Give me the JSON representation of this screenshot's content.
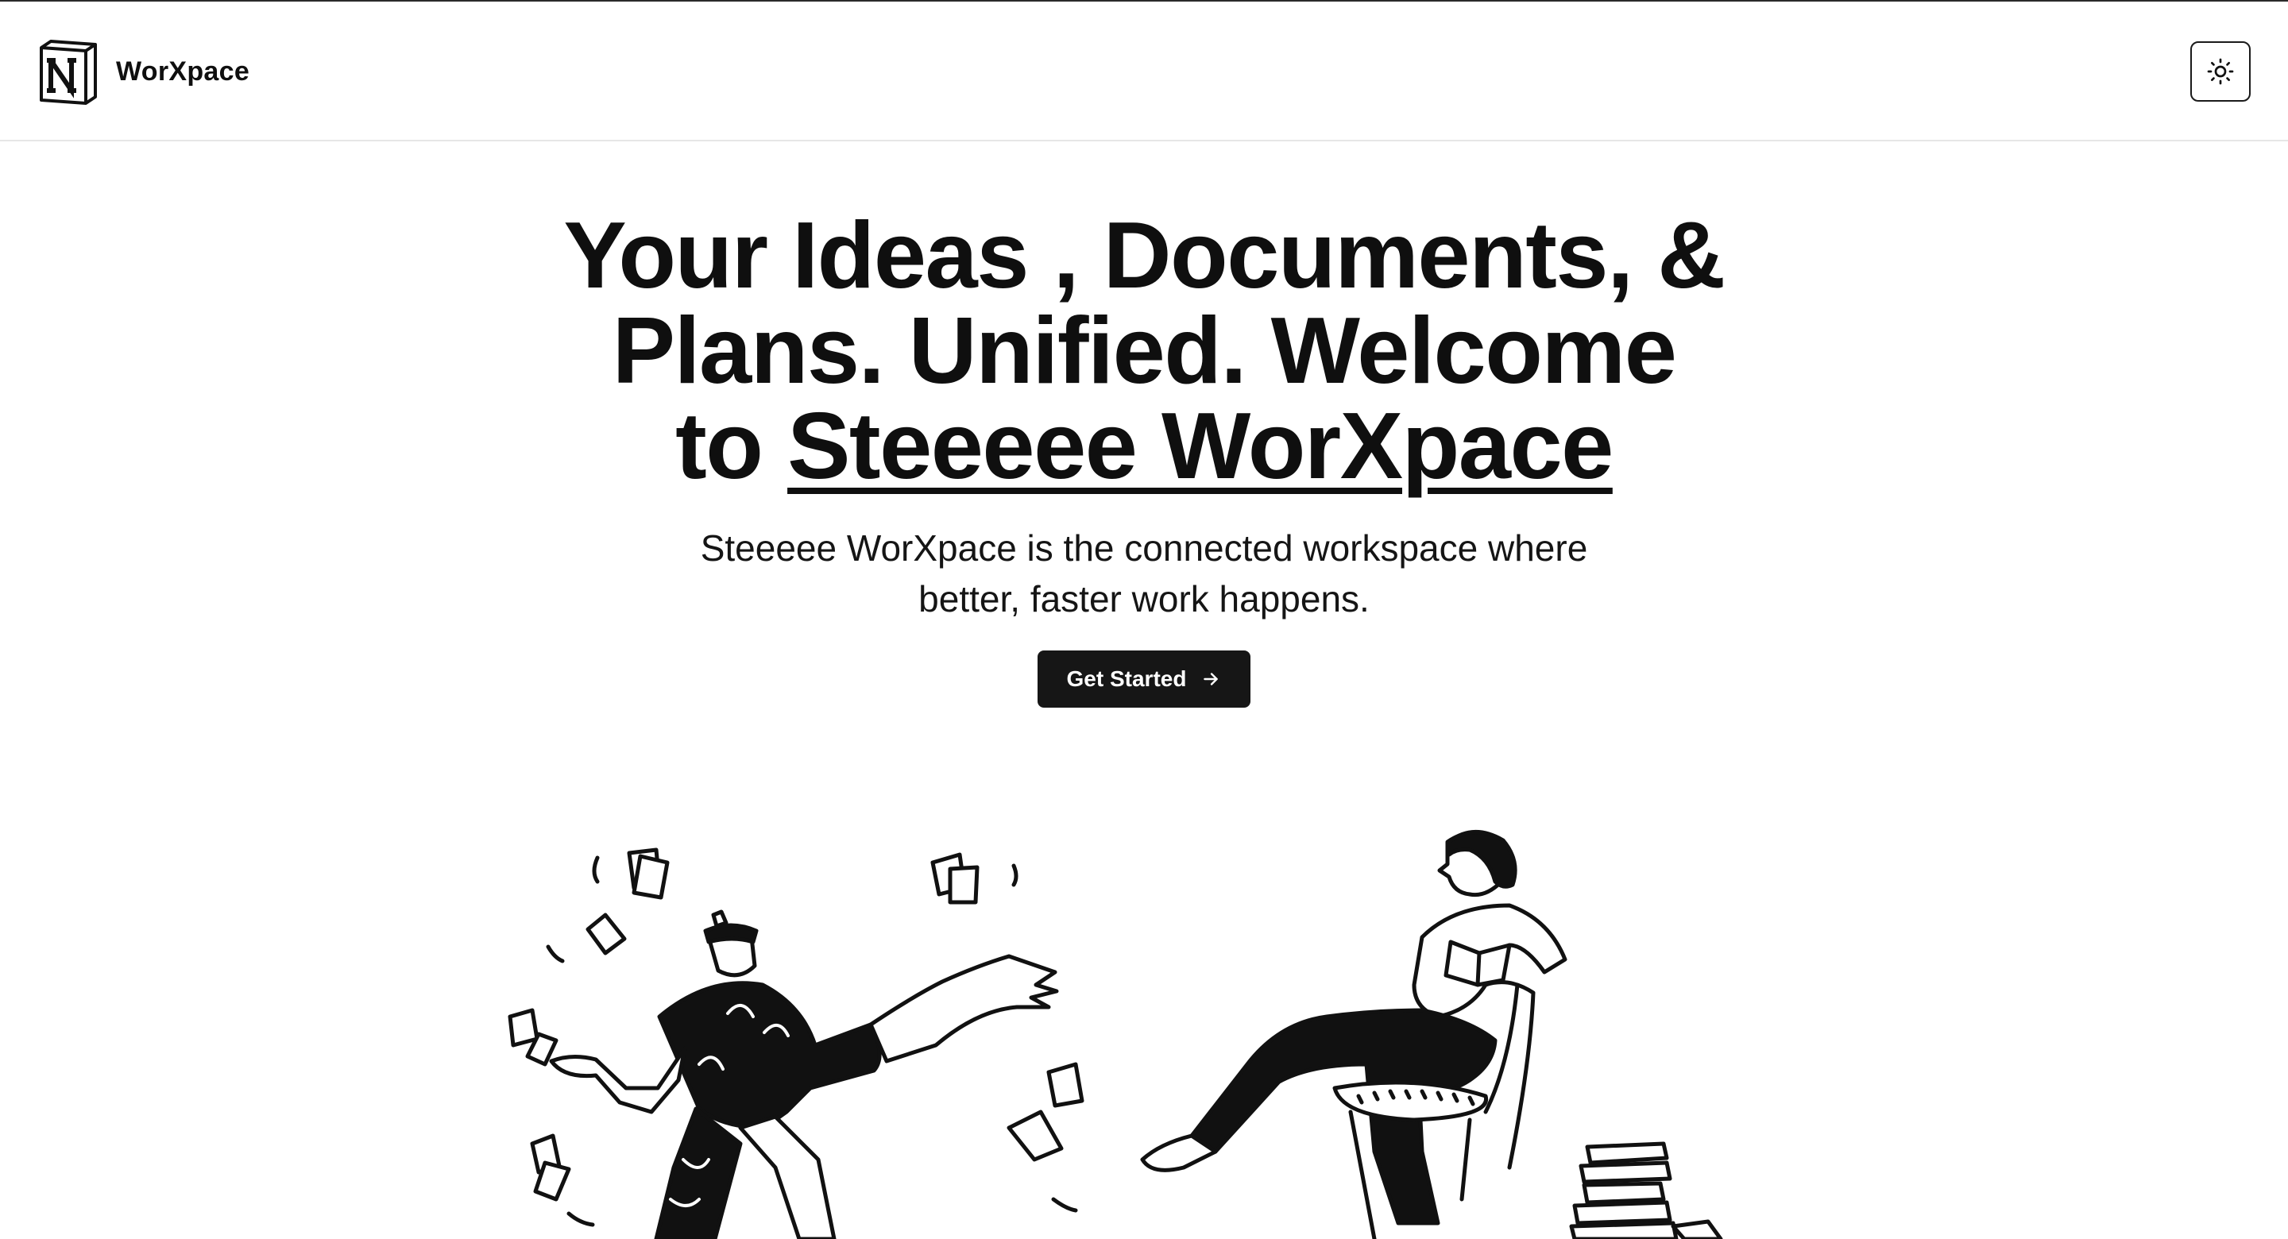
{
  "app": {
    "brand_name": "WorXpace",
    "logo": "notion-cube-logo-icon",
    "theme_toggle_icon": "sun-icon"
  },
  "hero": {
    "headline_line1": "Your Ideas , Documents, &",
    "headline_line2": "Plans. Unified. Welcome",
    "headline_prefix": "to ",
    "headline_brand": "Steeeee WorXpace",
    "subheading_line1": "Steeeee WorXpace is the connected workspace where",
    "subheading_line2": "better, faster work happens.",
    "cta_label": "Get Started",
    "cta_icon": "arrow-right-icon"
  },
  "illustrations": {
    "left": "person-juggling-papers-illustration",
    "right": "person-reading-on-chair-illustration"
  },
  "colors": {
    "text": "#0f0f0f",
    "button_bg": "#161616",
    "button_text": "#ffffff",
    "background": "#ffffff",
    "divider": "#e6e6e6"
  }
}
